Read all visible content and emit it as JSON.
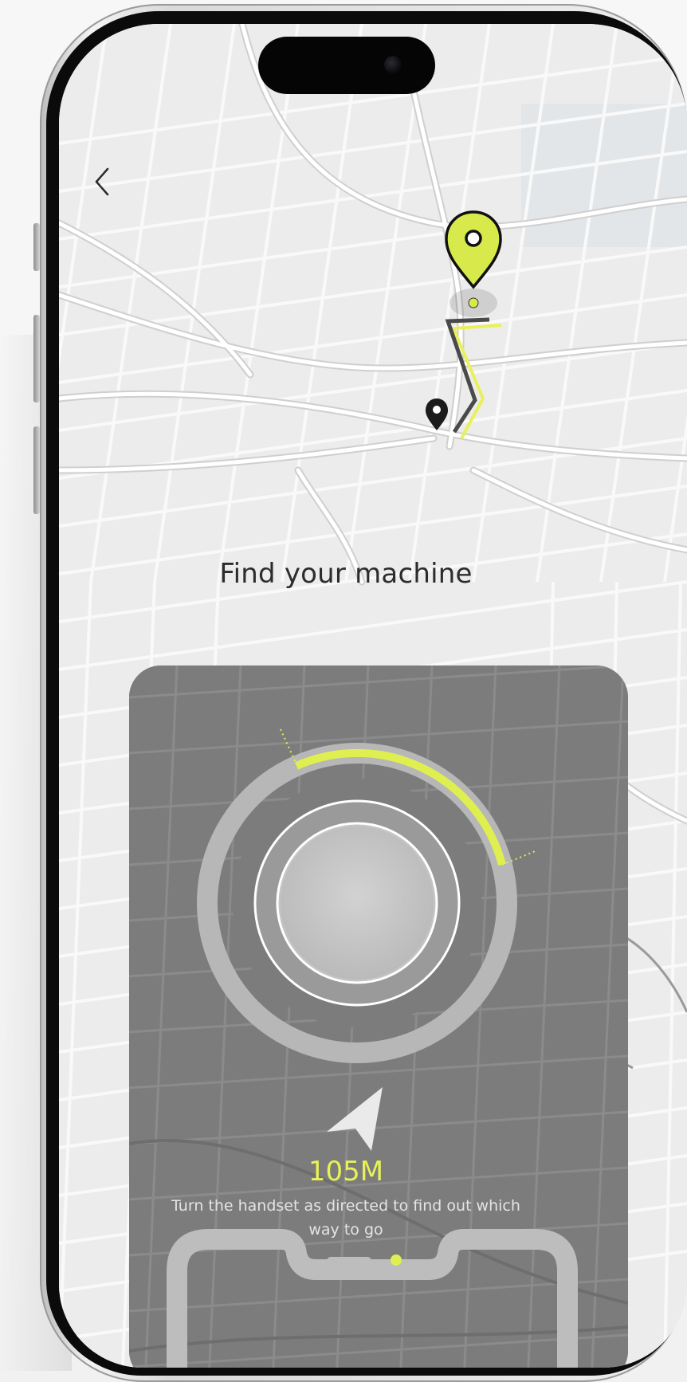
{
  "page": {
    "title": "Find your machine",
    "distance": "105M",
    "hint": "Turn the handset as directed to find out which way to go"
  },
  "icons": {
    "back": "chevron-left-icon",
    "destination_pin": "map-pin-icon",
    "origin_pin": "map-pin-icon",
    "direction_arrow": "navigation-arrow-icon"
  },
  "colors": {
    "accent": "#d8ea4b",
    "panel": "#7c7c7c",
    "map_bg": "#ededed",
    "road": "#ffffff",
    "route_dark": "#4a4a4a"
  },
  "compass": {
    "progress_fraction": 0.25
  }
}
